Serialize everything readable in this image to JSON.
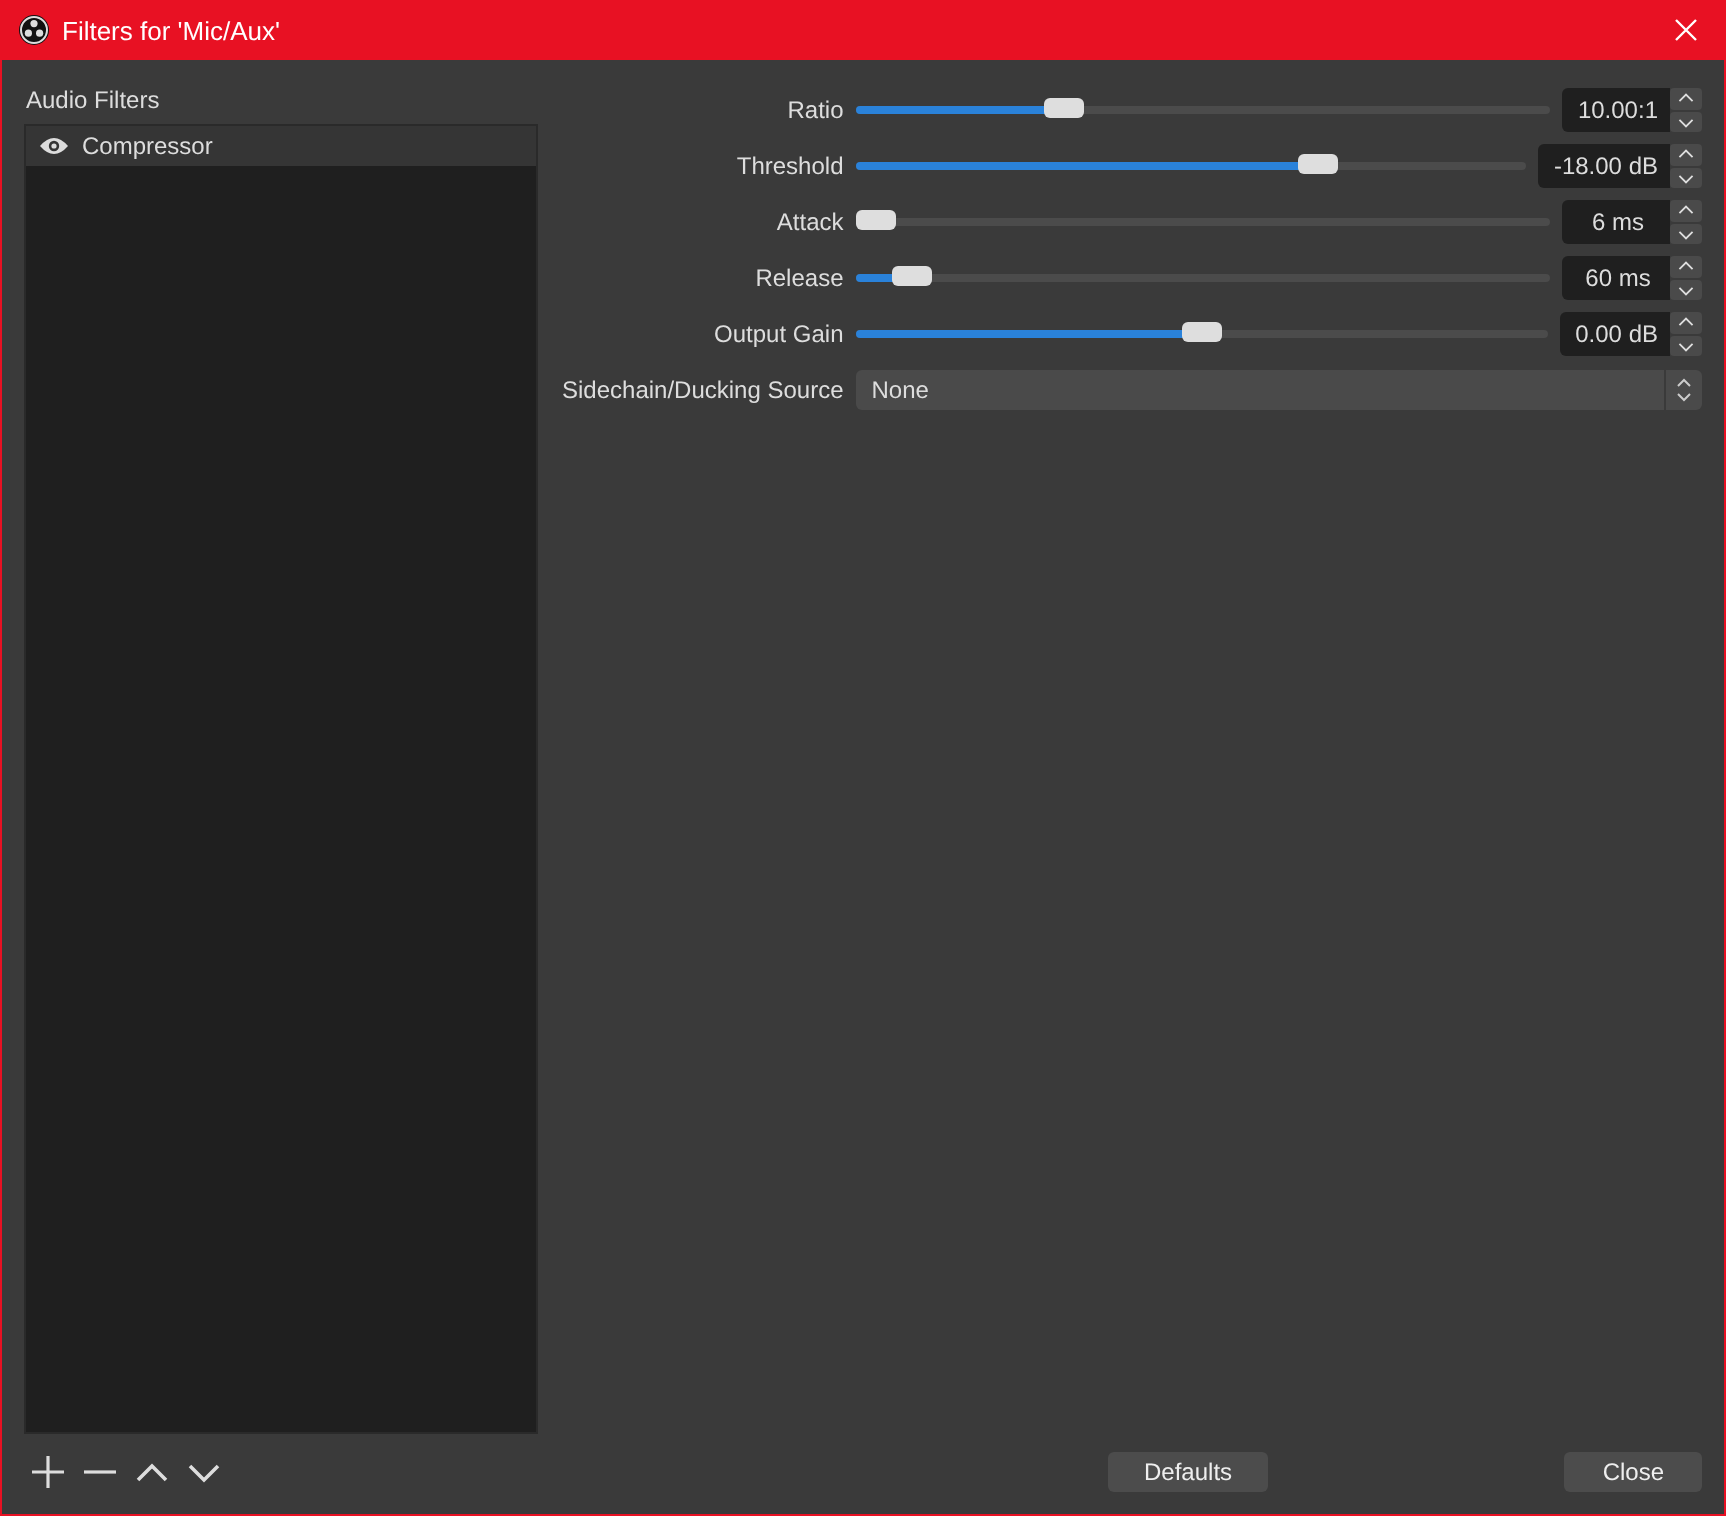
{
  "window": {
    "title": "Filters for 'Mic/Aux'"
  },
  "filters": {
    "label": "Audio Filters",
    "items": [
      {
        "name": "Compressor",
        "visible": true,
        "selected": true
      }
    ]
  },
  "settings": [
    {
      "kind": "slider",
      "label": "Ratio",
      "level": 0.3,
      "value": "10.00:1"
    },
    {
      "kind": "slider",
      "label": "Threshold",
      "level": 0.69,
      "value": "-18.00 dB"
    },
    {
      "kind": "slider",
      "label": "Attack",
      "level": 0.03,
      "value": "6 ms"
    },
    {
      "kind": "slider",
      "label": "Release",
      "level": 0.08,
      "value": "60 ms"
    },
    {
      "kind": "slider",
      "label": "Output Gain",
      "level": 0.5,
      "value": "0.00 dB"
    },
    {
      "kind": "dropdown",
      "label": "Sidechain/Ducking Source",
      "value": "None"
    }
  ],
  "buttons": [
    "Defaults",
    "Close"
  ]
}
